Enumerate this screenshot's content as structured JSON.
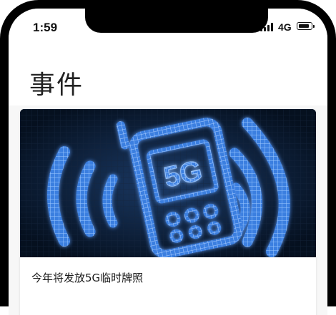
{
  "status_bar": {
    "time": "1:59",
    "network": "4G"
  },
  "header": {
    "title": "事件"
  },
  "article": {
    "title": "今年将发放5G临时牌照",
    "image": {
      "label": "5G",
      "accent_color": "#4f9cff"
    }
  }
}
